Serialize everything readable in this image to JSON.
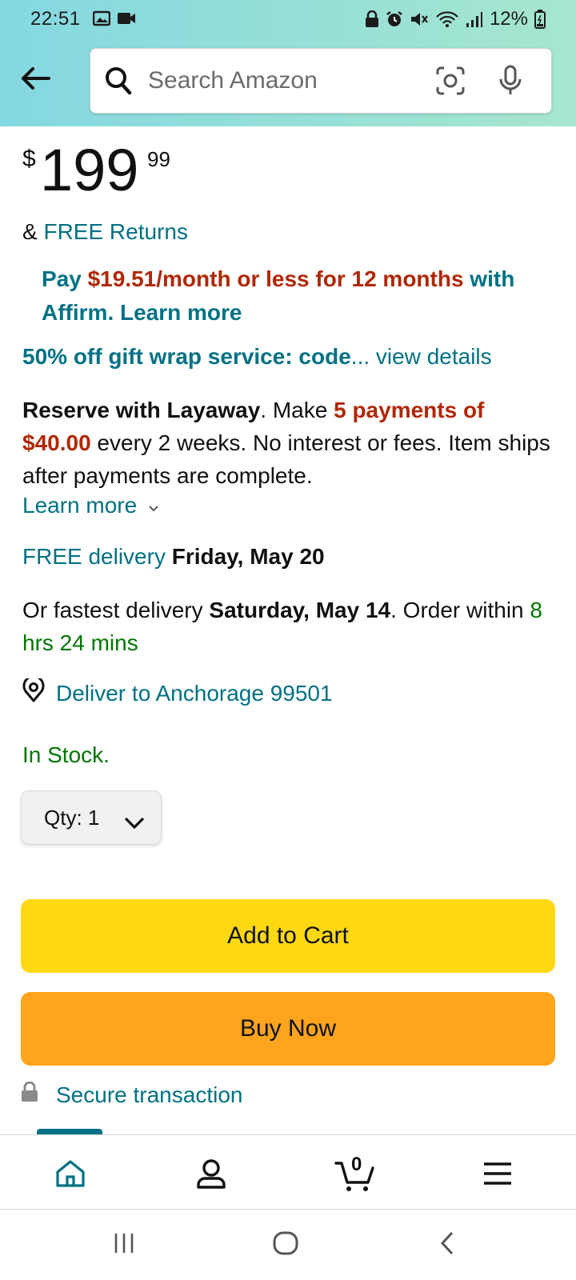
{
  "status_bar": {
    "time": "22:51",
    "battery": "12%",
    "left_icons": [
      "image-icon",
      "video-icon"
    ],
    "right_icons": [
      "lock-icon",
      "alarm-icon",
      "mute-icon",
      "wifi-icon",
      "signal-icon",
      "battery-icon"
    ]
  },
  "header": {
    "back_icon": "arrow-left-icon",
    "search_placeholder": "Search Amazon",
    "camera_icon": "camera-scan-icon",
    "mic_icon": "microphone-icon"
  },
  "product": {
    "price_symbol": "$",
    "price_whole": "199",
    "price_fraction": "99",
    "returns_prefix": "& ",
    "returns_link": "FREE Returns",
    "affirm_pay": "Pay ",
    "affirm_amount": "$19.51/month or less for 12 months",
    "affirm_rest": " with Affirm. Learn more",
    "giftwrap_bold": "50% off gift wrap service: code",
    "giftwrap_more": "... view details",
    "layaway_title": "Reserve with Layaway",
    "layaway_make": ". Make ",
    "layaway_payments": "5 payments of $40.00",
    "layaway_rest": " every 2 weeks. No interest or fees. Item ships after payments are complete.",
    "learn_more": "Learn more",
    "free_delivery_label": "FREE delivery",
    "free_delivery_date": "Friday, May 20",
    "fastest_prefix": "Or fastest delivery ",
    "fastest_date": "Saturday, May 14",
    "fastest_order": ". Order within ",
    "fastest_countdown": "8 hrs 24 mins",
    "deliver_to": "Deliver to Anchorage 99501",
    "stock": "In Stock.",
    "qty_label": "Qty:",
    "qty_value": "1",
    "add_to_cart": "Add to Cart",
    "buy_now": "Buy Now",
    "secure": "Secure transaction"
  },
  "bottom_nav": {
    "items": [
      "home-icon",
      "account-icon",
      "cart-icon",
      "menu-icon"
    ],
    "cart_count": "0",
    "active": "home-icon"
  },
  "system_nav": {
    "items": [
      "recent-apps-icon",
      "home-button-icon",
      "back-icon"
    ]
  },
  "colors": {
    "link": "#007185",
    "price_red": "#b12704",
    "stock_green": "#007600",
    "add_to_cart": "#ffd814",
    "buy_now": "#ffa41c",
    "header_gradient_start": "#84d8e1",
    "header_gradient_end": "#a6e6ce"
  }
}
